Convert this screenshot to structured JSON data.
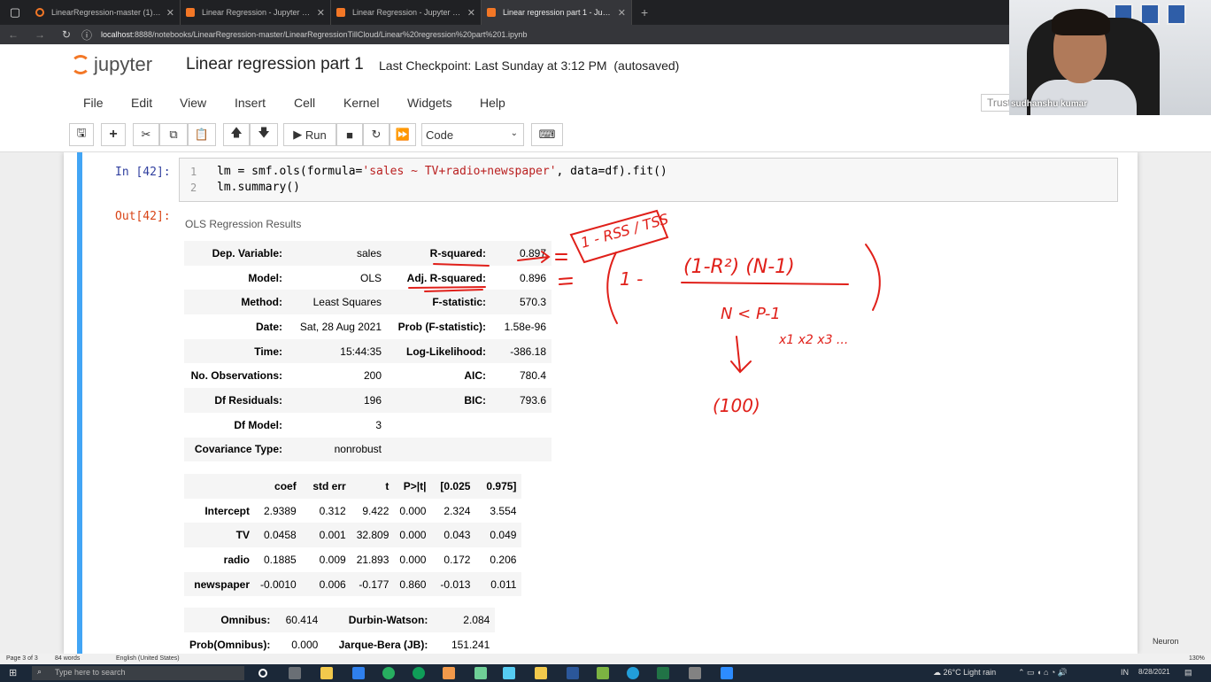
{
  "browser": {
    "tabs": [
      {
        "label": "LinearRegression-master (1) (4)/",
        "active": false
      },
      {
        "label": "Linear Regression - Jupyter Note",
        "active": false
      },
      {
        "label": "Linear Regression - Jupyter Note",
        "active": false
      },
      {
        "label": "Linear regression part 1 - Jupyte",
        "active": true
      }
    ],
    "url_host": "localhost",
    "url_rest": ":8888/notebooks/LinearRegression-master/LinearRegressionTillCloud/Linear%20regression%20part%201.ipynb"
  },
  "jupyter": {
    "logo": "jupyter",
    "notebook_title": "Linear regression part 1",
    "checkpoint": "Last Checkpoint: Last Sunday at 3:12 PM",
    "autosaved": "(autosaved)",
    "menu": [
      "File",
      "Edit",
      "View",
      "Insert",
      "Cell",
      "Kernel",
      "Widgets",
      "Help"
    ],
    "trusted": "Trusted",
    "toolbar": {
      "run_label": "Run",
      "cell_type": "Code"
    }
  },
  "cell": {
    "in_prompt": "In [42]:",
    "out_prompt": "Out[42]:",
    "line_numbers": [
      "1",
      "2"
    ],
    "code_line1_a": "lm = smf.ols(formula=",
    "code_line1_str": "'sales ~ TV+radio+newspaper'",
    "code_line1_b": ", data=df).fit()",
    "code_line2": "lm.summary()"
  },
  "ols": {
    "title": "OLS Regression Results",
    "summary_rows": [
      [
        "Dep. Variable:",
        "sales",
        "R-squared:",
        "0.897"
      ],
      [
        "Model:",
        "OLS",
        "Adj. R-squared:",
        "0.896"
      ],
      [
        "Method:",
        "Least Squares",
        "F-statistic:",
        "570.3"
      ],
      [
        "Date:",
        "Sat, 28 Aug 2021",
        "Prob (F-statistic):",
        "1.58e-96"
      ],
      [
        "Time:",
        "15:44:35",
        "Log-Likelihood:",
        "-386.18"
      ],
      [
        "No. Observations:",
        "200",
        "AIC:",
        "780.4"
      ],
      [
        "Df Residuals:",
        "196",
        "BIC:",
        "793.6"
      ],
      [
        "Df Model:",
        "3",
        "",
        ""
      ],
      [
        "Covariance Type:",
        "nonrobust",
        "",
        ""
      ]
    ],
    "coef_headers": [
      "",
      "coef",
      "std err",
      "t",
      "P>|t|",
      "[0.025",
      "0.975]"
    ],
    "coef_rows": [
      [
        "Intercept",
        "2.9389",
        "0.312",
        "9.422",
        "0.000",
        "2.324",
        "3.554"
      ],
      [
        "TV",
        "0.0458",
        "0.001",
        "32.809",
        "0.000",
        "0.043",
        "0.049"
      ],
      [
        "radio",
        "0.1885",
        "0.009",
        "21.893",
        "0.000",
        "0.172",
        "0.206"
      ],
      [
        "newspaper",
        "-0.0010",
        "0.006",
        "-0.177",
        "0.860",
        "-0.013",
        "0.011"
      ]
    ],
    "diag_rows": [
      [
        "Omnibus:",
        "60.414",
        "Durbin-Watson:",
        "2.084"
      ],
      [
        "Prob(Omnibus):",
        "0.000",
        "Jarque-Bera (JB):",
        "151.241"
      ]
    ]
  },
  "handwriting": {
    "box_note": "1 - RSS / TSS",
    "formula_left": "1 -",
    "formula_top": "(1-R²) (N-1)",
    "condition": "N < P-1",
    "vars": "x1 x2 x3 ...",
    "hundred": "(100)"
  },
  "webcam": {
    "name": "sudhanshu kumar"
  },
  "watermark": "Neuron",
  "statusbar": {
    "page": "Page 3 of 3",
    "words": "84 words",
    "language": "English (United States)",
    "zoom": "130%"
  },
  "taskbar": {
    "search": "Type here to search",
    "weather": "26°C  Light rain",
    "lang": "IN",
    "date": "8/28/2021"
  }
}
